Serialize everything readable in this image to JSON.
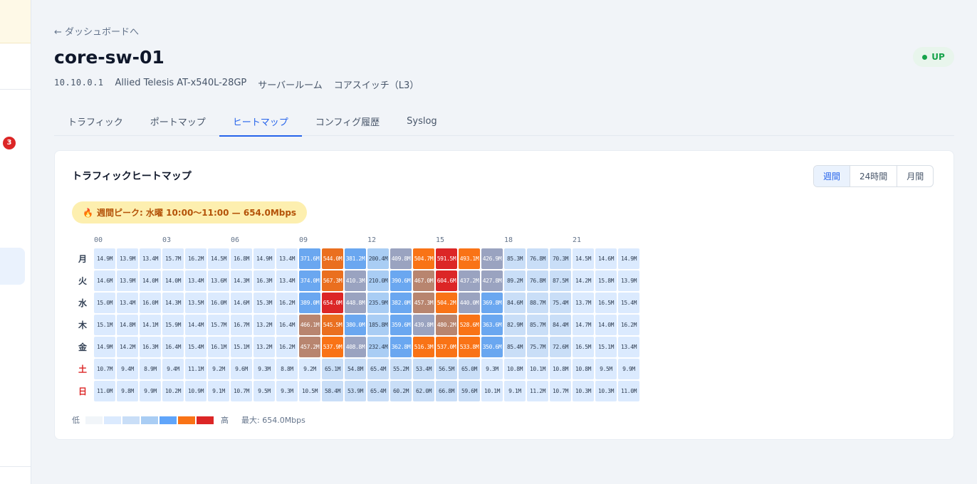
{
  "sidebar": {
    "badge": "3"
  },
  "back_link": "← ダッシュボードへ",
  "device": {
    "name": "core-sw-01",
    "status": "UP",
    "ip": "10.10.0.1",
    "model": "Allied Telesis AT-x540L-28GP",
    "location": "サーバールーム",
    "role": "コアスイッチ（L3）"
  },
  "tabs": [
    {
      "label": "トラフィック",
      "active": false
    },
    {
      "label": "ポートマップ",
      "active": false
    },
    {
      "label": "ヒートマップ",
      "active": true
    },
    {
      "label": "コンフィグ履歴",
      "active": false
    },
    {
      "label": "Syslog",
      "active": false
    }
  ],
  "heatmap_card": {
    "title": "トラフィックヒートマップ",
    "ranges": [
      {
        "label": "週間",
        "active": true
      },
      {
        "label": "24時間",
        "active": false
      },
      {
        "label": "月間",
        "active": false
      }
    ],
    "peak_label": "週間ピーク: 水曜 10:00〜11:00 — 654.0Mbps",
    "peak_icon": "flame-icon",
    "legend": {
      "low": "低",
      "high": "高",
      "max": "最大: 654.0Mbps"
    }
  },
  "colors": {
    "level_colors": [
      "#f1f5f9",
      "#dbeafe",
      "#c9def7",
      "#a9cdf4",
      "#60a5fa",
      "#f97316",
      "#dc2626"
    ]
  },
  "chart_data": {
    "type": "heatmap",
    "unit": "Mbps",
    "hours": [
      "00",
      "01",
      "02",
      "03",
      "04",
      "05",
      "06",
      "07",
      "08",
      "09",
      "10",
      "11",
      "12",
      "13",
      "14",
      "15",
      "16",
      "17",
      "18",
      "19",
      "20",
      "21",
      "22",
      "23"
    ],
    "hour_tick_labels": [
      "00",
      "03",
      "06",
      "09",
      "12",
      "15",
      "18",
      "21"
    ],
    "days": [
      {
        "label": "月",
        "weekend": false,
        "values": [
          "14.9M",
          "13.9M",
          "13.4M",
          "15.7M",
          "16.2M",
          "14.5M",
          "16.8M",
          "14.9M",
          "13.4M",
          "371.6M",
          "544.0M",
          "381.2M",
          "200.4M",
          "409.8M",
          "504.7M",
          "591.5M",
          "493.1M",
          "426.9M",
          "85.3M",
          "76.8M",
          "70.3M",
          "14.5M",
          "14.6M",
          "14.9M"
        ]
      },
      {
        "label": "火",
        "weekend": false,
        "values": [
          "14.6M",
          "13.9M",
          "14.0M",
          "14.0M",
          "13.4M",
          "13.6M",
          "14.3M",
          "16.3M",
          "13.4M",
          "374.0M",
          "567.3M",
          "410.3M",
          "210.0M",
          "390.6M",
          "467.0M",
          "604.6M",
          "437.2M",
          "427.8M",
          "89.2M",
          "76.8M",
          "87.5M",
          "14.2M",
          "15.8M",
          "13.9M"
        ]
      },
      {
        "label": "水",
        "weekend": false,
        "values": [
          "15.0M",
          "13.4M",
          "16.0M",
          "14.3M",
          "13.5M",
          "16.0M",
          "14.6M",
          "15.3M",
          "16.2M",
          "389.0M",
          "654.0M",
          "448.8M",
          "235.9M",
          "382.0M",
          "457.3M",
          "504.2M",
          "440.0M",
          "369.8M",
          "84.6M",
          "88.7M",
          "75.4M",
          "13.7M",
          "16.5M",
          "15.4M"
        ]
      },
      {
        "label": "木",
        "weekend": false,
        "values": [
          "15.1M",
          "14.8M",
          "14.1M",
          "15.9M",
          "14.4M",
          "15.7M",
          "16.7M",
          "13.2M",
          "16.4M",
          "466.1M",
          "545.5M",
          "380.0M",
          "185.8M",
          "359.6M",
          "439.8M",
          "480.2M",
          "528.6M",
          "363.6M",
          "82.9M",
          "85.7M",
          "84.4M",
          "14.7M",
          "14.0M",
          "16.2M"
        ]
      },
      {
        "label": "金",
        "weekend": false,
        "values": [
          "14.9M",
          "14.2M",
          "16.3M",
          "16.4M",
          "15.4M",
          "16.1M",
          "15.1M",
          "13.2M",
          "16.2M",
          "457.2M",
          "537.9M",
          "408.8M",
          "232.4M",
          "362.8M",
          "516.3M",
          "537.0M",
          "533.8M",
          "350.6M",
          "85.4M",
          "75.7M",
          "72.6M",
          "16.5M",
          "15.1M",
          "13.4M"
        ]
      },
      {
        "label": "土",
        "weekend": true,
        "values": [
          "10.7M",
          "9.4M",
          "8.9M",
          "9.4M",
          "11.1M",
          "9.2M",
          "9.6M",
          "9.3M",
          "8.8M",
          "9.2M",
          "65.1M",
          "54.8M",
          "65.4M",
          "55.2M",
          "53.4M",
          "56.5M",
          "65.0M",
          "9.3M",
          "10.8M",
          "10.1M",
          "10.8M",
          "10.8M",
          "9.5M",
          "9.9M"
        ]
      },
      {
        "label": "日",
        "weekend": true,
        "values": [
          "11.0M",
          "9.8M",
          "9.9M",
          "10.2M",
          "10.9M",
          "9.1M",
          "10.7M",
          "9.5M",
          "9.3M",
          "10.5M",
          "58.4M",
          "53.9M",
          "65.4M",
          "60.2M",
          "62.0M",
          "66.8M",
          "59.6M",
          "10.1M",
          "9.1M",
          "11.2M",
          "10.7M",
          "10.3M",
          "10.3M",
          "11.0M"
        ]
      }
    ],
    "max_value": 654.0
  }
}
